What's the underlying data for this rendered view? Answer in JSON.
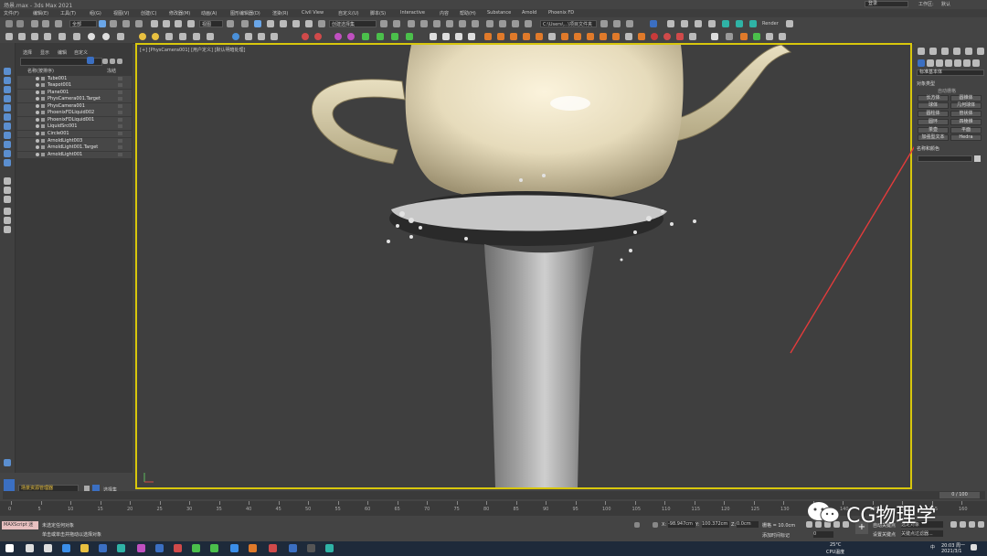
{
  "window": {
    "title": "场景.max - 3ds Max 2021",
    "workspace_label": "工作区:",
    "workspace_value": "默认",
    "signin": "登录"
  },
  "menu": [
    "文件(F)",
    "编辑(E)",
    "工具(T)",
    "组(G)",
    "视图(V)",
    "创建(C)",
    "修改器(M)",
    "动画(A)",
    "图形编辑器(D)",
    "渲染(R)",
    "Civil View",
    "自定义(U)",
    "脚本(S)",
    "Interactive",
    "内容",
    "帮助(H)",
    "Substance",
    "Arnold",
    "Phoenix FD"
  ],
  "toolbar": {
    "selection_filter": "全部",
    "ref_coord": "视图",
    "named_sel": "创建选择集",
    "user_dropdown": "C:\\Users\\...\\项目文件夹",
    "rename_label": "Render"
  },
  "scene_explorer": {
    "tabs": [
      "选择",
      "显示",
      "编辑",
      "自定义"
    ],
    "header": "名称(按排序)",
    "frozen_header": "冻结",
    "items": [
      {
        "name": "Tube001"
      },
      {
        "name": "Teapot001"
      },
      {
        "name": "Plane001"
      },
      {
        "name": "PhysCamera001.Target"
      },
      {
        "name": "PhysCamera001"
      },
      {
        "name": "PhoenixFDLiquid002"
      },
      {
        "name": "PhoenixFDLiquid001"
      },
      {
        "name": "LiquidSrc001"
      },
      {
        "name": "Circle001"
      },
      {
        "name": "ArnoldLight003"
      },
      {
        "name": "ArnoldLight001.Target"
      },
      {
        "name": "ArnoldLight001"
      }
    ],
    "layer_button": "场景资源管理器",
    "layer_label": "选择集"
  },
  "viewport": {
    "label": "[+] [PhysCamera001] [用户定义] [默认明暗处理]"
  },
  "command_panel": {
    "category": "标准基本体",
    "rollout_object_type": "对象类型",
    "autogrid": "自动栅格",
    "buttons": [
      "长方体",
      "圆锥体",
      "球体",
      "几何球体",
      "圆柱体",
      "管状体",
      "圆环",
      "四棱锥",
      "茶壶",
      "平面",
      "加强型文本",
      "Hedra"
    ],
    "rollout_name_color": "名称和颜色"
  },
  "timeline": {
    "frame_counter": "0 / 100",
    "ticks": [
      "0",
      "5",
      "10",
      "15",
      "20",
      "25",
      "30",
      "35",
      "40",
      "45",
      "50",
      "55",
      "60",
      "65",
      "70",
      "75",
      "80",
      "85",
      "90",
      "95",
      "100",
      "105",
      "110",
      "115",
      "120",
      "125",
      "130",
      "135",
      "140",
      "145",
      "150",
      "155",
      "160"
    ]
  },
  "status": {
    "maxscript": "MAXScript 迷",
    "line1": "未选定任何对象",
    "line2": "单击或单击并拖动以选择对象",
    "x_label": "X:",
    "x_value": "-98.947cm",
    "y_label": "Y:",
    "y_value": "100.372cm",
    "z_label": "Z:",
    "z_value": "0.0cm",
    "grid": "栅格 = 10.0cm",
    "add_time_tag": "添加时间标记",
    "autokey": "自动关键点",
    "setkey": "设置关键点",
    "selected_label": "选定对象",
    "keyfilter": "关键点过滤器...",
    "frame_value": "0"
  },
  "watermark": "CG物理学",
  "taskbar": {
    "temp": "25°C",
    "cpu": "CPU温度",
    "time": "20:03 周一",
    "date": "2021/3/1",
    "lang": "中"
  }
}
